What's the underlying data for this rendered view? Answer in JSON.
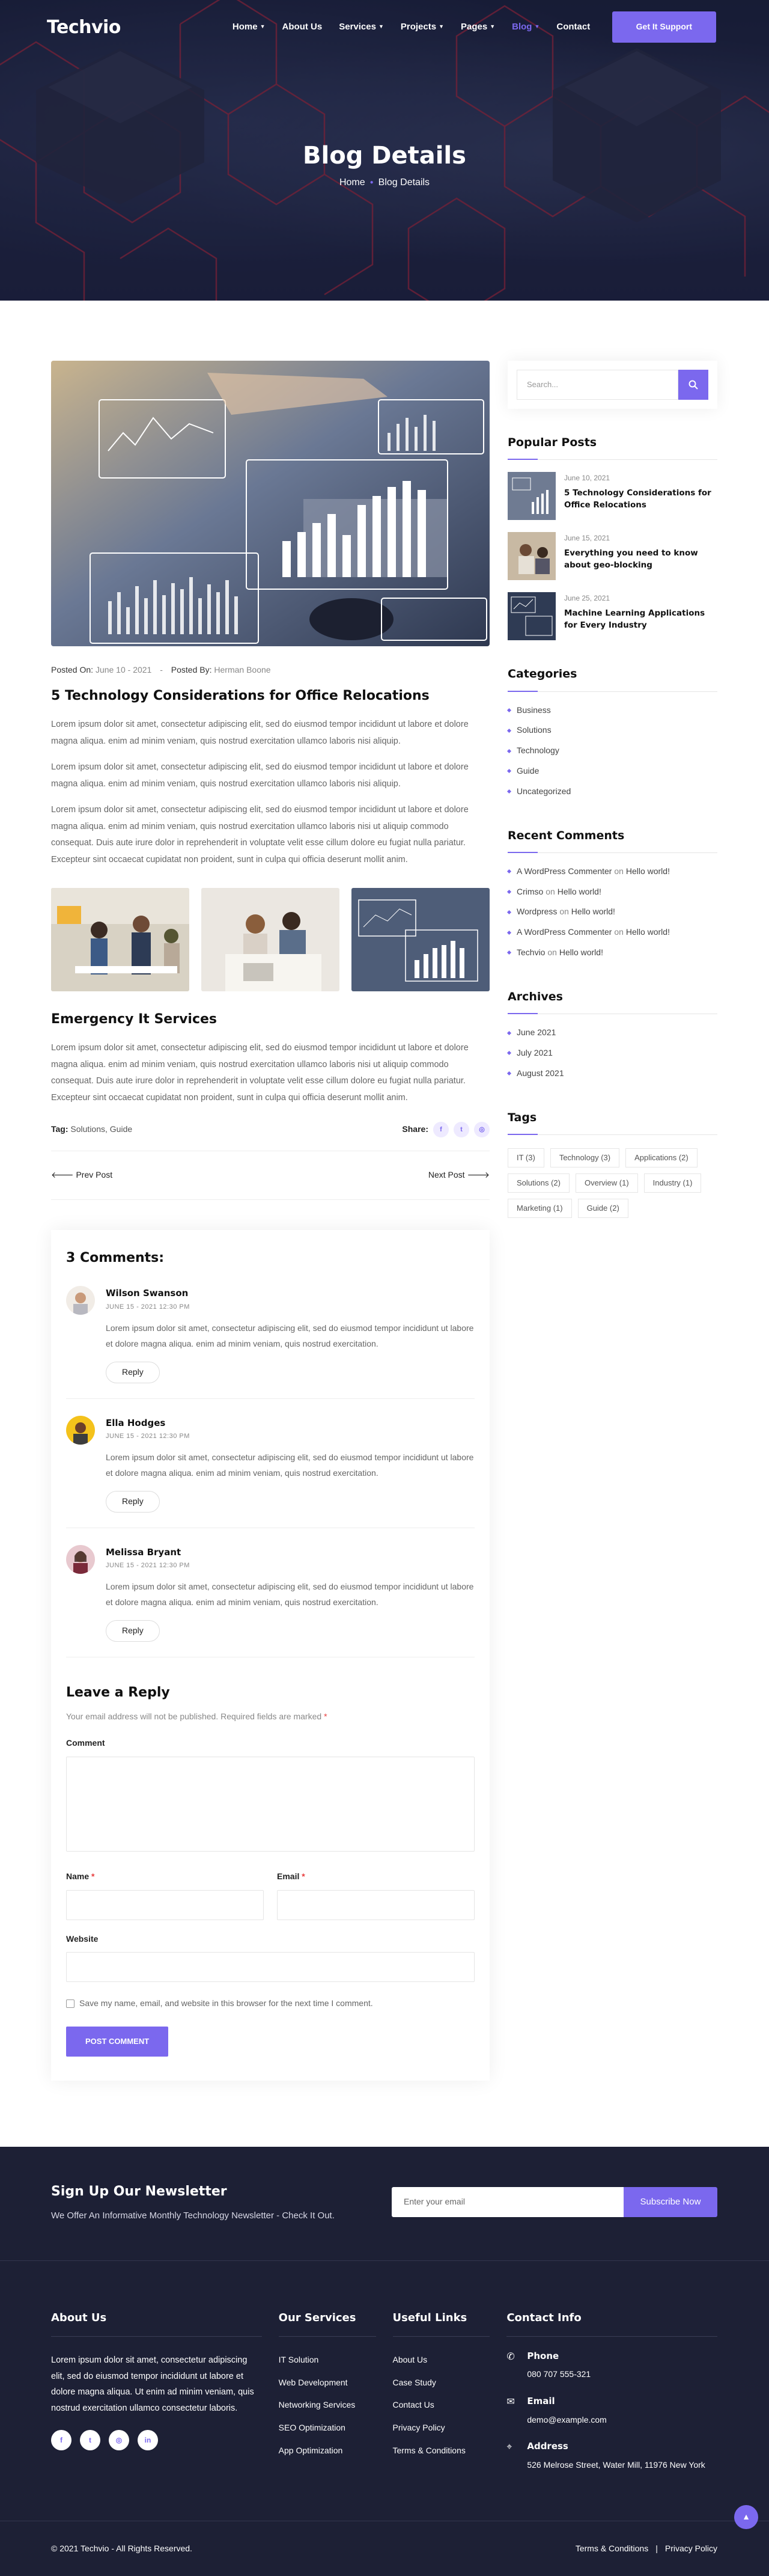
{
  "brand": {
    "logo": "Techvio",
    "accent": "#7b68ee"
  },
  "nav": {
    "items": [
      {
        "label": "Home",
        "dropdown": true
      },
      {
        "label": "About Us",
        "dropdown": false
      },
      {
        "label": "Services",
        "dropdown": true
      },
      {
        "label": "Projects",
        "dropdown": true
      },
      {
        "label": "Pages",
        "dropdown": true
      },
      {
        "label": "Blog",
        "dropdown": true,
        "active": true
      },
      {
        "label": "Contact",
        "dropdown": false
      }
    ],
    "cta": "Get It Support"
  },
  "hero": {
    "title": "Blog Details",
    "crumb_home": "Home",
    "crumb_current": "Blog Details"
  },
  "post": {
    "meta_on_label": "Posted On:",
    "meta_on_value": "June 10 - 2021",
    "meta_by_label": "Posted By:",
    "meta_by_value": "Herman Boone",
    "title": "5 Technology Considerations for Office Relocations",
    "p1": "Lorem ipsum dolor sit amet, consectetur adipiscing elit, sed do eiusmod tempor incididunt ut labore et dolore magna aliqua. enim ad minim veniam, quis nostrud exercitation ullamco laboris nisi aliquip.",
    "p2": "Lorem ipsum dolor sit amet, consectetur adipiscing elit, sed do eiusmod tempor incididunt ut labore et dolore magna aliqua. enim ad minim veniam, quis nostrud exercitation ullamco laboris nisi aliquip.",
    "p3": "Lorem ipsum dolor sit amet, consectetur adipiscing elit, sed do eiusmod tempor incididunt ut labore et dolore magna aliqua. enim ad minim veniam, quis nostrud exercitation ullamco laboris nisi ut aliquip commodo consequat. Duis aute irure dolor in reprehenderit in voluptate velit esse cillum dolore eu fugiat nulla pariatur. Excepteur sint occaecat cupidatat non proident, sunt in culpa qui officia deserunt mollit anim.",
    "subtitle": "Emergency It Services",
    "p4": "Lorem ipsum dolor sit amet, consectetur adipiscing elit, sed do eiusmod tempor incididunt ut labore et dolore magna aliqua. enim ad minim veniam, quis nostrud exercitation ullamco laboris nisi ut aliquip commodo consequat. Duis aute irure dolor in reprehenderit in voluptate velit esse cillum dolore eu fugiat nulla pariatur. Excepteur sint occaecat cupidatat non proident, sunt in culpa qui officia deserunt mollit anim.",
    "tag_label": "Tag:",
    "tags": "Solutions, Guide",
    "share_label": "Share:",
    "share_icons": [
      "facebook-icon",
      "twitter-icon",
      "instagram-icon"
    ],
    "prev": "Prev Post",
    "next": "Next Post"
  },
  "comments": {
    "title": "3 Comments:",
    "reply_label": "Reply",
    "items": [
      {
        "name": "Wilson Swanson",
        "date": "JUNE 15 - 2021 12:30 PM",
        "text": "Lorem ipsum dolor sit amet, consectetur adipiscing elit, sed do eiusmod tempor incididunt ut labore et dolore magna aliqua. enim ad minim veniam, quis nostrud exercitation."
      },
      {
        "name": "Ella Hodges",
        "date": "JUNE 15 - 2021 12:30 PM",
        "text": "Lorem ipsum dolor sit amet, consectetur adipiscing elit, sed do eiusmod tempor incididunt ut labore et dolore magna aliqua. enim ad minim veniam, quis nostrud exercitation."
      },
      {
        "name": "Melissa Bryant",
        "date": "JUNE 15 - 2021 12:30 PM",
        "text": "Lorem ipsum dolor sit amet, consectetur adipiscing elit, sed do eiusmod tempor incididunt ut labore et dolore magna aliqua. enim ad minim veniam, quis nostrud exercitation."
      }
    ]
  },
  "reply_form": {
    "title": "Leave a Reply",
    "note": "Your email address will not be published. Required fields are marked",
    "comment_label": "Comment",
    "name_label": "Name",
    "email_label": "Email",
    "website_label": "Website",
    "save_label": "Save my name, email, and website in this browser for the next time I comment.",
    "submit": "POST COMMENT"
  },
  "sidebar": {
    "search_placeholder": "Search...",
    "popular_title": "Popular Posts",
    "popular": [
      {
        "date": "June 10, 2021",
        "title": "5 Technology Considerations for Office Relocations"
      },
      {
        "date": "June 15, 2021",
        "title": "Everything you need to know about geo-blocking"
      },
      {
        "date": "June 25, 2021",
        "title": "Machine Learning Applications for Every Industry"
      }
    ],
    "categories_title": "Categories",
    "categories": [
      "Business",
      "Solutions",
      "Technology",
      "Guide",
      "Uncategorized"
    ],
    "recent_title": "Recent Comments",
    "recent": [
      {
        "author": "A WordPress Commenter",
        "on": "on",
        "post": "Hello world!"
      },
      {
        "author": "Crimso",
        "on": "on",
        "post": "Hello world!"
      },
      {
        "author": "Wordpress",
        "on": "on",
        "post": "Hello world!"
      },
      {
        "author": "A WordPress Commenter",
        "on": "on",
        "post": "Hello world!"
      },
      {
        "author": "Techvio",
        "on": "on",
        "post": "Hello world!"
      }
    ],
    "archives_title": "Archives",
    "archives": [
      "June 2021",
      "July 2021",
      "August 2021"
    ],
    "tags_title": "Tags",
    "tags": [
      "IT (3)",
      "Technology (3)",
      "Applications (2)",
      "Solutions (2)",
      "Overview (1)",
      "Industry (1)",
      "Marketing (1)",
      "Guide (2)"
    ]
  },
  "newsletter": {
    "title": "Sign Up Our Newsletter",
    "subtitle": "We Offer An Informative Monthly Technology Newsletter - Check It Out.",
    "placeholder": "Enter your email",
    "button": "Subscribe Now"
  },
  "footer": {
    "about_title": "About Us",
    "about_text": "Lorem ipsum dolor sit amet, consectetur adipiscing elit, sed do eiusmod tempor incididunt ut labore et dolore magna aliqua. Ut enim ad minim veniam, quis nostrud exercitation ullamco consectetur laboris.",
    "social": [
      "facebook-icon",
      "twitter-icon",
      "instagram-icon",
      "linkedin-icon"
    ],
    "services_title": "Our Services",
    "services": [
      "IT Solution",
      "Web Development",
      "Networking Services",
      "SEO Optimization",
      "App Optimization"
    ],
    "links_title": "Useful Links",
    "links": [
      "About Us",
      "Case Study",
      "Contact Us",
      "Privacy Policy",
      "Terms & Conditions"
    ],
    "contact_title": "Contact Info",
    "phone_label": "Phone",
    "phone": "080 707 555-321",
    "email_label": "Email",
    "email": "demo@example.com",
    "address_label": "Address",
    "address": "526 Melrose Street, Water Mill, 11976 New York",
    "copyright": "© 2021 Techvio - All Rights Reserved.",
    "terms": "Terms & Conditions",
    "privacy": "Privacy Policy"
  }
}
